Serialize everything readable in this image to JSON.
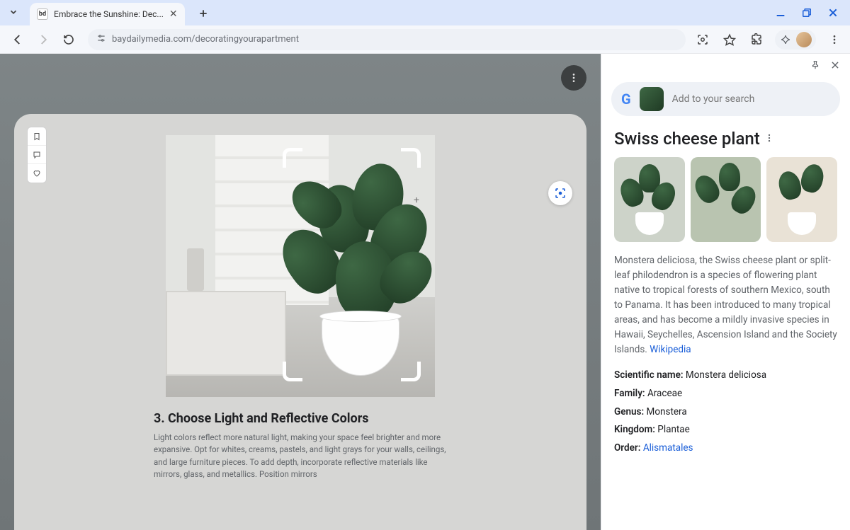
{
  "tab": {
    "title": "Embrace the Sunshine: Dec...",
    "favicon": "bd"
  },
  "url": "baydailymedia.com/decoratingyourapartment",
  "article": {
    "heading": "3. Choose Light and Reflective Colors",
    "body": "Light colors reflect more natural light, making your space feel brighter and more expansive. Opt for whites, creams, pastels, and light grays for your walls, ceilings, and large furniture pieces. To add depth, incorporate reflective materials like mirrors, glass, and metallics. Position mirrors"
  },
  "sidepanel": {
    "search_placeholder": "Add to your search",
    "title": "Swiss cheese plant",
    "description": "Monstera deliciosa, the Swiss cheese plant or split-leaf philodendron is a species of flowering plant native to tropical forests of southern Mexico, south to Panama. It has been introduced to many tropical areas, and has become a mildly invasive species in Hawaii, Seychelles, Ascension Island and the Society Islands.",
    "source": "Wikipedia",
    "facts": {
      "scientific_name_label": "Scientific name:",
      "scientific_name": "Monstera deliciosa",
      "family_label": "Family:",
      "family": "Araceae",
      "genus_label": "Genus:",
      "genus": "Monstera",
      "kingdom_label": "Kingdom:",
      "kingdom": "Plantae",
      "order_label": "Order:",
      "order": "Alismatales"
    }
  }
}
